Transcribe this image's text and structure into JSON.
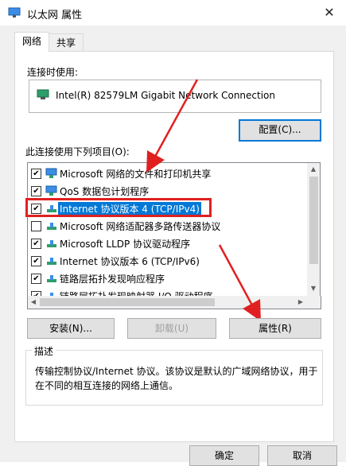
{
  "window": {
    "title": "以太网 属性",
    "close": "✕"
  },
  "tabs": [
    {
      "label": "网络"
    },
    {
      "label": "共享"
    }
  ],
  "connect_using": {
    "label": "连接时使用:",
    "adapter": "Intel(R) 82579LM Gigabit Network Connection",
    "configure_button": "配置(C)..."
  },
  "items_section": {
    "label": "此连接使用下列项目(O):"
  },
  "items": [
    {
      "label": "Microsoft 网络的文件和打印机共享",
      "checked": true,
      "icon": "network-share-icon"
    },
    {
      "label": "QoS 数据包计划程序",
      "checked": true,
      "icon": "network-share-icon"
    },
    {
      "label": "Internet 协议版本 4 (TCP/IPv4)",
      "checked": true,
      "icon": "protocol-icon",
      "selected": true
    },
    {
      "label": "Microsoft 网络适配器多路传送器协议",
      "checked": false,
      "icon": "protocol-icon"
    },
    {
      "label": "Microsoft LLDP 协议驱动程序",
      "checked": true,
      "icon": "protocol-icon"
    },
    {
      "label": "Internet 协议版本 6 (TCP/IPv6)",
      "checked": true,
      "icon": "protocol-icon"
    },
    {
      "label": "链路层拓扑发现响应程序",
      "checked": true,
      "icon": "protocol-icon"
    },
    {
      "label": "链路层拓扑发现映射器 I/O 驱动程序",
      "checked": true,
      "icon": "protocol-icon"
    }
  ],
  "buttons": {
    "install": "安装(N)...",
    "uninstall": "卸载(U)",
    "properties": "属性(R)",
    "ok": "确定",
    "cancel": "取消"
  },
  "description": {
    "label": "描述",
    "text": "传输控制协议/Internet 协议。该协议是默认的广域网络协议，用于在不同的相互连接的网络上通信。"
  },
  "colors": {
    "selection": "#0078d7",
    "annotation": "#e02020"
  }
}
